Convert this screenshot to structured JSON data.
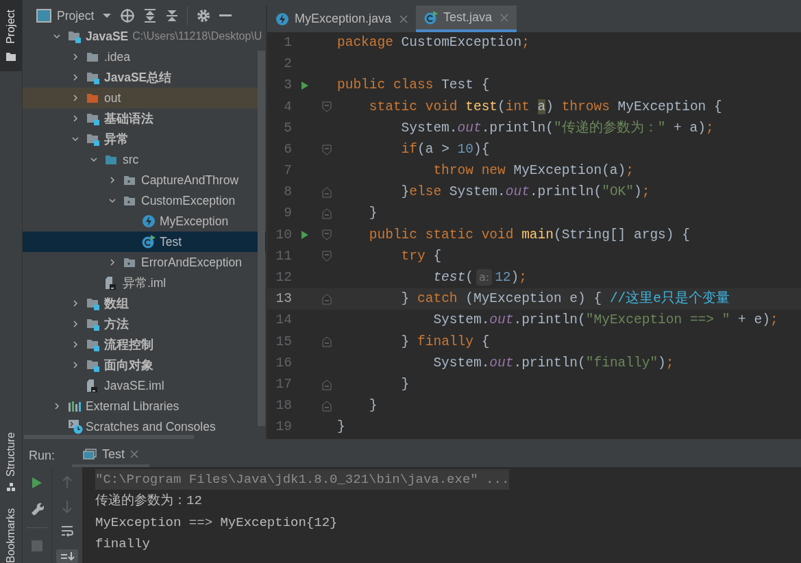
{
  "tool_strip": {
    "top": [
      {
        "label": "Project",
        "selected": true
      }
    ],
    "bottom": [
      {
        "label": "Structure",
        "selected": false
      },
      {
        "label": "Bookmarks",
        "selected": false
      }
    ]
  },
  "project_panel": {
    "title": "Project",
    "tree": [
      {
        "label": "JavaSE",
        "path": "C:\\Users\\11218\\Desktop\\U",
        "kind": "module",
        "expanded": true,
        "selected": false,
        "children": [
          {
            "label": ".idea",
            "kind": "folder",
            "expanded": false,
            "selected": false
          },
          {
            "label": "JavaSE总结",
            "kind": "module",
            "expanded": false,
            "selected": false
          },
          {
            "label": "out",
            "kind": "excluded",
            "expanded": false,
            "selected": false
          },
          {
            "label": "基础语法",
            "kind": "module",
            "expanded": false,
            "selected": false
          },
          {
            "label": "异常",
            "kind": "module",
            "expanded": true,
            "selected": false,
            "children": [
              {
                "label": "src",
                "kind": "source",
                "expanded": true,
                "selected": false,
                "children": [
                  {
                    "label": "CaptureAndThrow",
                    "kind": "package",
                    "expanded": false,
                    "selected": false
                  },
                  {
                    "label": "CustomException",
                    "kind": "package",
                    "expanded": true,
                    "selected": false,
                    "children": [
                      {
                        "label": "MyException",
                        "kind": "exception",
                        "selected": false
                      },
                      {
                        "label": "Test",
                        "kind": "class",
                        "selected": true
                      }
                    ]
                  },
                  {
                    "label": "ErrorAndException",
                    "kind": "package",
                    "expanded": false,
                    "selected": false
                  }
                ]
              },
              {
                "label": "异常.iml",
                "kind": "iml",
                "selected": false
              }
            ]
          },
          {
            "label": "数组",
            "kind": "module",
            "expanded": false,
            "selected": false
          },
          {
            "label": "方法",
            "kind": "module",
            "expanded": false,
            "selected": false
          },
          {
            "label": "流程控制",
            "kind": "module",
            "expanded": false,
            "selected": false
          },
          {
            "label": "面向对象",
            "kind": "module",
            "expanded": false,
            "selected": false
          },
          {
            "label": "JavaSE.iml",
            "kind": "iml",
            "selected": false
          }
        ]
      },
      {
        "label": "External Libraries",
        "kind": "libraries",
        "expanded": false,
        "selected": false
      },
      {
        "label": "Scratches and Consoles",
        "kind": "scratches",
        "selected": false
      }
    ]
  },
  "editor": {
    "tabs": [
      {
        "label": "MyException.java",
        "kind": "exception",
        "selected": false
      },
      {
        "label": "Test.java",
        "kind": "class",
        "selected": true
      }
    ],
    "lines": [
      {
        "number": "1",
        "run": false,
        "fold_start": false,
        "fold_end": false,
        "current": false,
        "tokens": [
          {
            "kind": "keyword",
            "text": "package"
          },
          {
            "kind": "plain",
            "text": " CustomException"
          },
          {
            "kind": "keyword",
            "text": ";"
          }
        ]
      },
      {
        "number": "2",
        "run": false,
        "fold_start": false,
        "fold_end": false,
        "current": false
      },
      {
        "number": "3",
        "run": true,
        "fold_start": false,
        "fold_end": false,
        "current": false,
        "tokens": [
          {
            "kind": "keyword",
            "text": "public class"
          },
          {
            "kind": "plain",
            "text": " Test {"
          }
        ]
      },
      {
        "number": "4",
        "run": false,
        "fold_start": true,
        "fold_end": false,
        "current": false,
        "tokens": [
          {
            "kind": "keyword",
            "text": "    static void "
          },
          {
            "kind": "method",
            "text": "test"
          },
          {
            "kind": "plain",
            "text": "("
          },
          {
            "kind": "keyword",
            "text": "int "
          },
          {
            "kind": "usage",
            "text": "a"
          },
          {
            "kind": "plain",
            "text": ") "
          },
          {
            "kind": "keyword",
            "text": "throws"
          },
          {
            "kind": "plain",
            "text": " MyException {"
          }
        ]
      },
      {
        "number": "5",
        "run": false,
        "fold_start": false,
        "fold_end": false,
        "current": false,
        "tokens": [
          {
            "kind": "plain",
            "text": "        System."
          },
          {
            "kind": "field",
            "text": "out"
          },
          {
            "kind": "plain",
            "text": ".println("
          },
          {
            "kind": "string",
            "text": "\"传递的参数为：\""
          },
          {
            "kind": "plain",
            "text": " + a)"
          },
          {
            "kind": "keyword",
            "text": ";"
          }
        ]
      },
      {
        "number": "6",
        "run": false,
        "fold_start": true,
        "fold_end": false,
        "current": false,
        "tokens": [
          {
            "kind": "keyword",
            "text": "        if"
          },
          {
            "kind": "plain",
            "text": "(a > "
          },
          {
            "kind": "number",
            "text": "10"
          },
          {
            "kind": "plain",
            "text": "){"
          }
        ]
      },
      {
        "number": "7",
        "run": false,
        "fold_start": false,
        "fold_end": false,
        "current": false,
        "tokens": [
          {
            "kind": "keyword",
            "text": "            throw new"
          },
          {
            "kind": "plain",
            "text": " MyException(a)"
          },
          {
            "kind": "keyword",
            "text": ";"
          }
        ]
      },
      {
        "number": "8",
        "run": false,
        "fold_start": false,
        "fold_end": true,
        "current": false,
        "tokens": [
          {
            "kind": "plain",
            "text": "        }"
          },
          {
            "kind": "keyword",
            "text": "else"
          },
          {
            "kind": "plain",
            "text": " System."
          },
          {
            "kind": "field",
            "text": "out"
          },
          {
            "kind": "plain",
            "text": ".println("
          },
          {
            "kind": "string",
            "text": "\"OK\""
          },
          {
            "kind": "plain",
            "text": ")"
          },
          {
            "kind": "keyword",
            "text": ";"
          }
        ]
      },
      {
        "number": "9",
        "run": false,
        "fold_start": false,
        "fold_end": true,
        "current": false,
        "tokens": [
          {
            "kind": "plain",
            "text": "    }"
          }
        ]
      },
      {
        "number": "10",
        "run": true,
        "fold_start": true,
        "fold_end": false,
        "current": false,
        "tokens": [
          {
            "kind": "keyword",
            "text": "    public static void "
          },
          {
            "kind": "method",
            "text": "main"
          },
          {
            "kind": "plain",
            "text": "(String[] args) {"
          }
        ]
      },
      {
        "number": "11",
        "run": false,
        "fold_start": true,
        "fold_end": false,
        "current": false,
        "tokens": [
          {
            "kind": "keyword",
            "text": "        try"
          },
          {
            "kind": "plain",
            "text": " {"
          }
        ]
      },
      {
        "number": "12",
        "run": false,
        "fold_start": false,
        "fold_end": false,
        "current": false,
        "tokens": [
          {
            "kind": "call",
            "text": "            test"
          },
          {
            "kind": "plain",
            "text": "("
          },
          {
            "kind": "hint",
            "text": "a:"
          },
          {
            "kind": "number",
            "text": "12"
          },
          {
            "kind": "plain",
            "text": ")"
          },
          {
            "kind": "keyword",
            "text": ";"
          }
        ]
      },
      {
        "number": "13",
        "run": false,
        "fold_start": false,
        "fold_end": true,
        "current": true,
        "tokens": [
          {
            "kind": "plain",
            "text": "        } "
          },
          {
            "kind": "keyword",
            "text": "catch"
          },
          {
            "kind": "plain",
            "text": " (MyException e) { "
          },
          {
            "kind": "comment",
            "text": "//这里e只是个变量"
          }
        ]
      },
      {
        "number": "14",
        "run": false,
        "fold_start": false,
        "fold_end": false,
        "current": false,
        "tokens": [
          {
            "kind": "plain",
            "text": "            System."
          },
          {
            "kind": "field",
            "text": "out"
          },
          {
            "kind": "plain",
            "text": ".println("
          },
          {
            "kind": "string",
            "text": "\"MyException ==> \""
          },
          {
            "kind": "plain",
            "text": " + e)"
          },
          {
            "kind": "keyword",
            "text": ";"
          }
        ]
      },
      {
        "number": "15",
        "run": false,
        "fold_start": false,
        "fold_end": true,
        "current": false,
        "tokens": [
          {
            "kind": "plain",
            "text": "        } "
          },
          {
            "kind": "keyword",
            "text": "finally"
          },
          {
            "kind": "plain",
            "text": " {"
          }
        ]
      },
      {
        "number": "16",
        "run": false,
        "fold_start": false,
        "fold_end": false,
        "current": false,
        "tokens": [
          {
            "kind": "plain",
            "text": "            System."
          },
          {
            "kind": "field",
            "text": "out"
          },
          {
            "kind": "plain",
            "text": ".println("
          },
          {
            "kind": "string",
            "text": "\"finally\""
          },
          {
            "kind": "plain",
            "text": ")"
          },
          {
            "kind": "keyword",
            "text": ";"
          }
        ]
      },
      {
        "number": "17",
        "run": false,
        "fold_start": false,
        "fold_end": true,
        "current": false,
        "tokens": [
          {
            "kind": "plain",
            "text": "        }"
          }
        ]
      },
      {
        "number": "18",
        "run": false,
        "fold_start": false,
        "fold_end": true,
        "current": false,
        "tokens": [
          {
            "kind": "plain",
            "text": "    }"
          }
        ]
      },
      {
        "number": "19",
        "run": false,
        "fold_start": false,
        "fold_end": false,
        "current": false,
        "tokens": [
          {
            "kind": "plain",
            "text": "}"
          }
        ]
      }
    ]
  },
  "run_panel": {
    "label": "Run:",
    "tabs": [
      {
        "label": "Test",
        "selected": true
      }
    ],
    "console": [
      {
        "kind": "command",
        "text": "\"C:\\Program Files\\Java\\jdk1.8.0_321\\bin\\java.exe\" ..."
      },
      {
        "kind": "output",
        "text": "传递的参数为：12"
      },
      {
        "kind": "output",
        "text": "MyException ==> MyException{12}"
      },
      {
        "kind": "output",
        "text": "finally"
      }
    ]
  }
}
